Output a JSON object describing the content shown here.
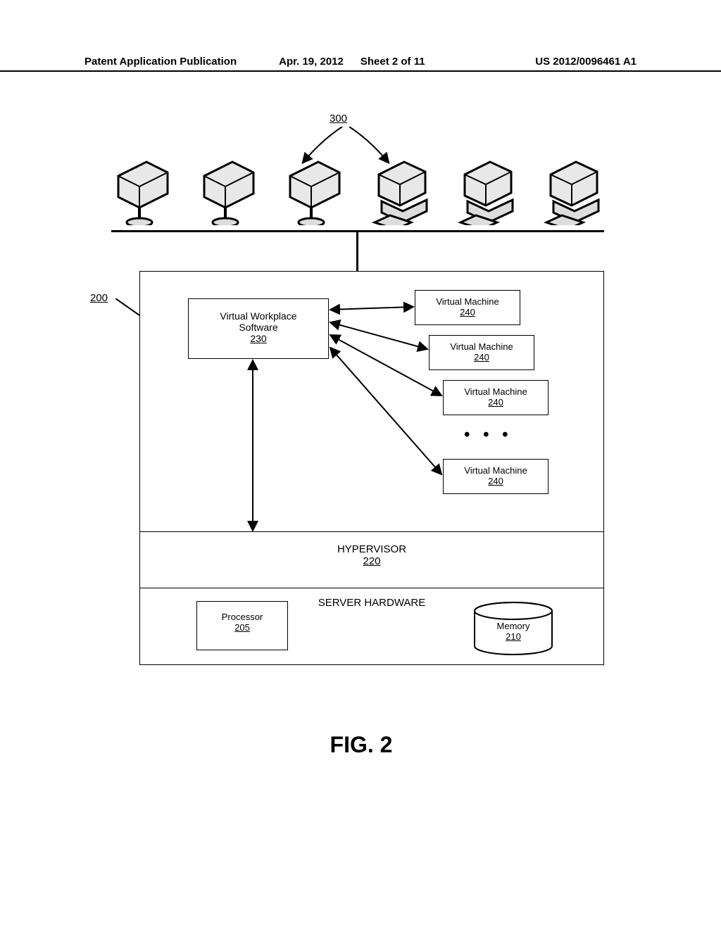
{
  "header": {
    "publication": "Patent Application Publication",
    "date": "Apr. 19, 2012",
    "sheet": "Sheet 2 of 11",
    "docnum": "US 2012/0096461 A1"
  },
  "refs": {
    "clients": "300",
    "server": "200"
  },
  "software_box": {
    "line1": "Virtual Workplace",
    "line2": "Software",
    "num": "230"
  },
  "vm": {
    "label": "Virtual Machine",
    "num": "240"
  },
  "dots": "• • •",
  "hypervisor": {
    "label": "HYPERVISOR",
    "num": "220"
  },
  "hardware": {
    "label": "SERVER HARDWARE",
    "processor_label": "Processor",
    "processor_num": "205",
    "memory_label": "Memory",
    "memory_num": "210"
  },
  "caption": "FIG. 2"
}
